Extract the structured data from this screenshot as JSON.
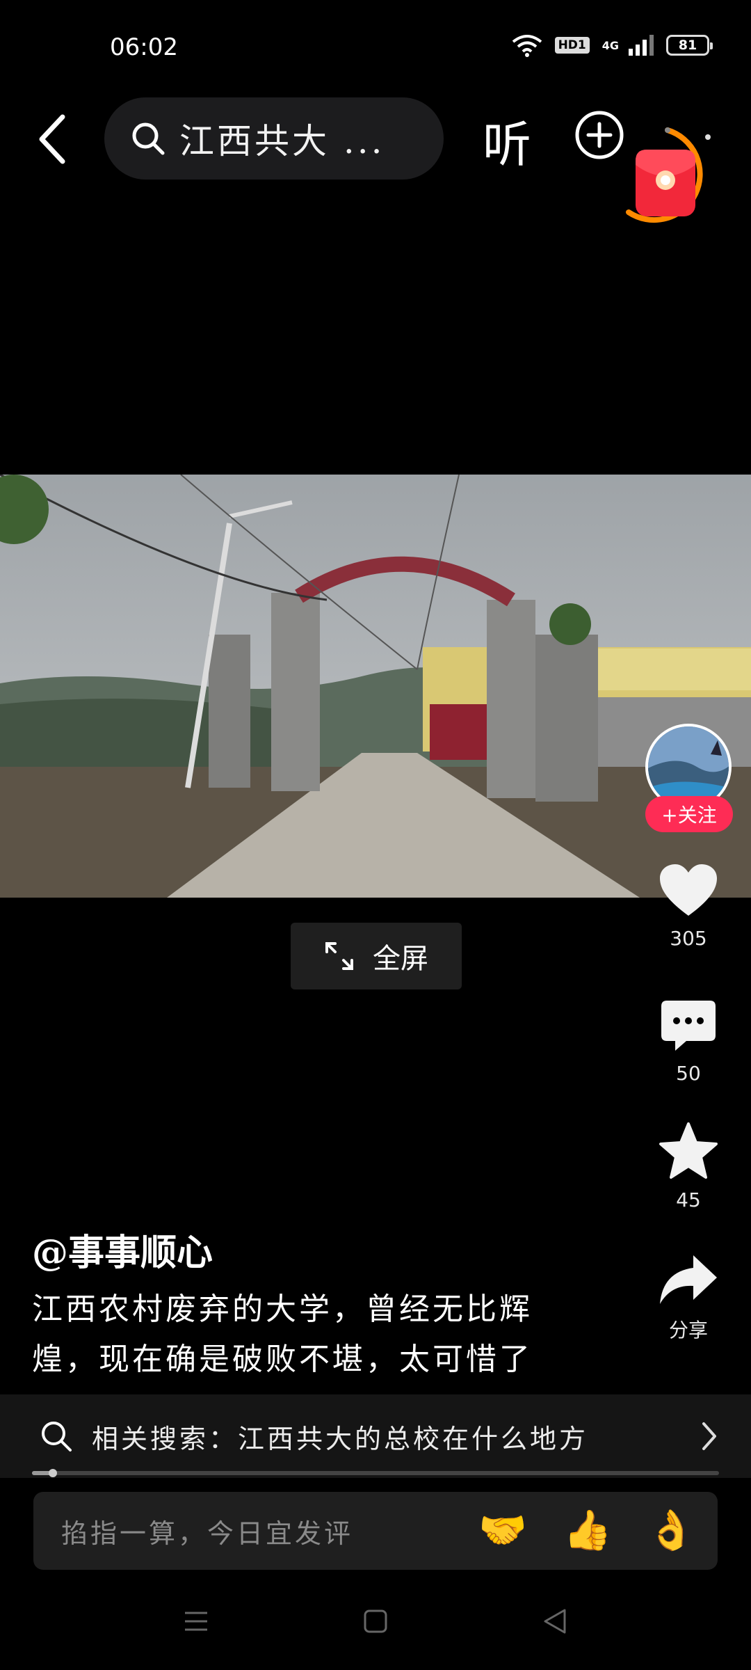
{
  "status_bar": {
    "time": "06:02",
    "hd_label": "HD1",
    "network_label": "4G",
    "battery": "81"
  },
  "top_nav": {
    "search_query": "江西共大 ...",
    "listen_label": "听",
    "icons": [
      "back-chevron-icon",
      "search-icon",
      "add-circle-icon",
      "red-packet-icon"
    ]
  },
  "video": {
    "fullscreen_label": "全屏"
  },
  "right_rail": {
    "follow_label": "+关注",
    "like_count": "305",
    "comment_count": "50",
    "favorite_count": "45",
    "share_label": "分享"
  },
  "caption": {
    "author": "@事事顺心",
    "line1": "江西农村废弃的大学，曾经无比辉",
    "line2": "煌，现在确是破败不堪，太可惜了"
  },
  "related_search": {
    "text": "相关搜索：江西共大的总校在什么地方"
  },
  "playback": {
    "progress": 0.03
  },
  "comment_bar": {
    "placeholder": "掐指一算，今日宜发评",
    "emojis": [
      "🤝",
      "👍",
      "👌"
    ]
  },
  "colors": {
    "accent": "#fe2c55",
    "background": "#000000",
    "red_packet_ring": "#ff8a00"
  }
}
